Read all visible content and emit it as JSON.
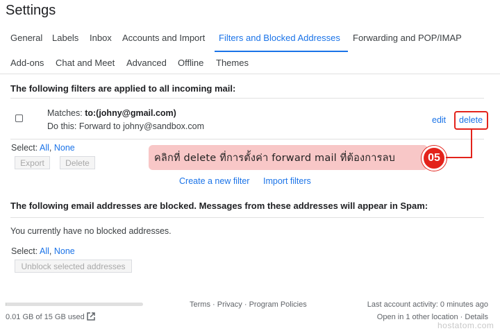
{
  "page": {
    "title": "Settings"
  },
  "tabs": [
    {
      "label": "General",
      "active": false
    },
    {
      "label": "Labels",
      "active": false
    },
    {
      "label": "Inbox",
      "active": false
    },
    {
      "label": "Accounts and Import",
      "active": false
    },
    {
      "label": "Filters and Blocked Addresses",
      "active": true
    },
    {
      "label": "Forwarding and POP/IMAP",
      "active": false
    },
    {
      "label": "Add-ons",
      "active": false
    },
    {
      "label": "Chat and Meet",
      "active": false
    },
    {
      "label": "Advanced",
      "active": false
    },
    {
      "label": "Offline",
      "active": false
    },
    {
      "label": "Themes",
      "active": false
    }
  ],
  "filters": {
    "heading": "The following filters are applied to all incoming mail:",
    "item": {
      "matches_label": "Matches:",
      "matches_value": "to:(johny@gmail.com)",
      "do_this": "Do this: Forward to johny@sandbox.com",
      "edit": "edit",
      "delete": "delete"
    },
    "select_label": "Select:",
    "select_all": "All",
    "select_none": "None",
    "export_button": "Export",
    "delete_button": "Delete",
    "create_filter": "Create a new filter",
    "import_filters": "Import filters"
  },
  "blocked": {
    "heading": "The following email addresses are blocked. Messages from these addresses will appear in Spam:",
    "empty_text": "You currently have no blocked addresses.",
    "select_label": "Select:",
    "select_all": "All",
    "select_none": "None",
    "unblock_button": "Unblock selected addresses"
  },
  "footer": {
    "storage": "0.01 GB of 15 GB used",
    "storage_fraction": 0.001,
    "terms": "Terms",
    "privacy": "Privacy",
    "policies": "Program Policies",
    "separator": " · ",
    "activity": "Last account activity: 0 minutes ago",
    "open_location": "Open in 1 other location",
    "details": "Details"
  },
  "annotation": {
    "text": "คลิกที่ delete ที่การตั้งค่า forward mail ที่ต้องการลบ",
    "step": "05",
    "color": "#e3231b",
    "box_color": "#f8c7c7"
  },
  "watermark": "hostatom.com",
  "colors": {
    "accent": "#1a73e8",
    "text": "#202124"
  }
}
